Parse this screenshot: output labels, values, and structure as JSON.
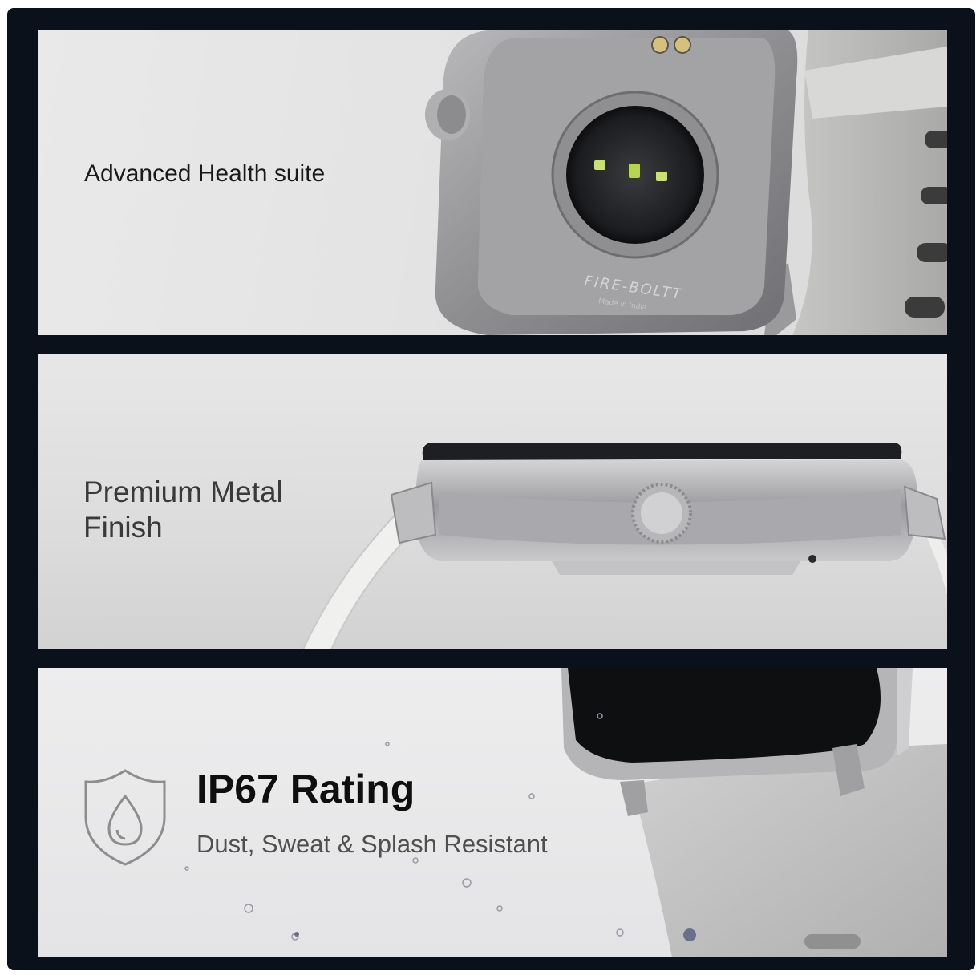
{
  "panels": {
    "health": {
      "caption": "Advanced Health suite",
      "brand_engraving": "FIRE-BOLTT",
      "origin_engraving": "Made in India"
    },
    "metal": {
      "caption_line1": "Premium Metal",
      "caption_line2": "Finish"
    },
    "ip67": {
      "title": "IP67 Rating",
      "subtitle": "Dust, Sweat & Splash Resistant"
    }
  },
  "icons": {
    "shield": "water-shield-icon"
  },
  "colors": {
    "frame": "#0b111b",
    "panel": "#e4e4e4",
    "text_dark": "#0f0f0f",
    "text_muted": "#505050",
    "sensor_green": "#c8e26a"
  }
}
